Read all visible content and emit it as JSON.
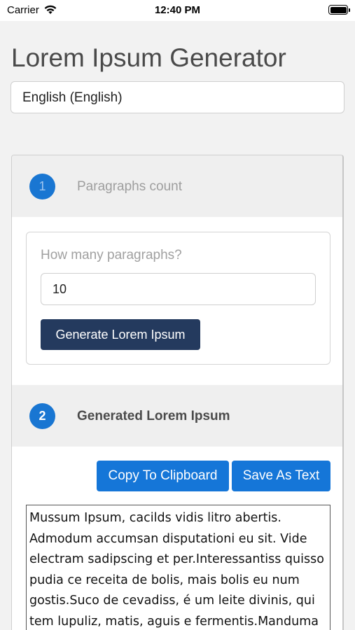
{
  "status_bar": {
    "carrier": "Carrier",
    "time": "12:40 PM",
    "icons": [
      "wifi-icon",
      "battery-icon"
    ]
  },
  "header": {
    "title": "Lorem Ipsum Generator"
  },
  "language": {
    "selected": "English (English)"
  },
  "step1": {
    "number": "1",
    "title": "Paragraphs count",
    "question": "How many paragraphs?",
    "count_value": "10",
    "generate_label": "Generate Lorem Ipsum"
  },
  "step2": {
    "number": "2",
    "title": "Generated Lorem Ipsum",
    "copy_label": "Copy To Clipboard",
    "save_label": "Save As Text",
    "output_text": "Mussum Ipsum, cacilds vidis litro abertis. Admodum accumsan disputationi eu sit. Vide electram sadipscing et per.Interessantiss quisso pudia ce receita de bolis, mais bolis eu num gostis.Suco de cevadiss, é um leite divinis, qui tem lupuliz, matis, aguis e fermentis.Manduma"
  },
  "colors": {
    "accent_blue": "#1976d2",
    "button_blue": "#1576d8",
    "navy": "#243a5e",
    "title_gray": "#4a4a4a",
    "background": "#f2f2f2"
  }
}
